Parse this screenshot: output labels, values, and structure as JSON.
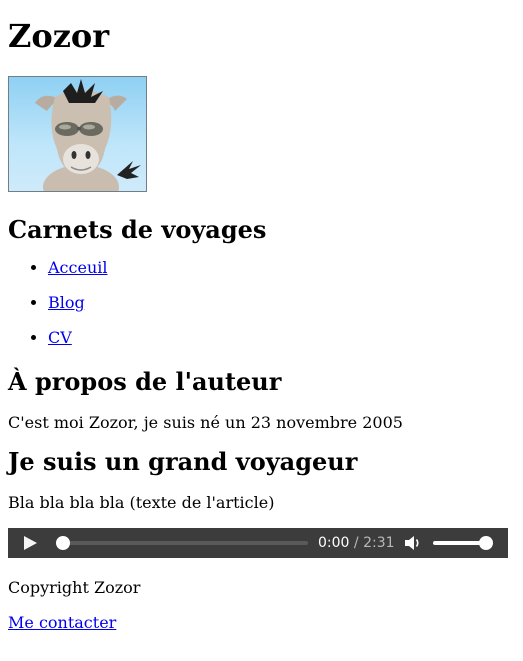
{
  "header": {
    "title": "Zozor",
    "logo_icon": "zozor-donkey-icon"
  },
  "tagline": "Carnets de voyages",
  "nav": {
    "items": [
      {
        "label": "Acceuil"
      },
      {
        "label": "Blog"
      },
      {
        "label": "CV"
      }
    ]
  },
  "about": {
    "heading": "À propos de l'auteur",
    "text": "C'est moi Zozor, je suis né un 23 novembre 2005"
  },
  "article": {
    "heading": "Je suis un grand voyageur",
    "text": "Bla bla bla bla (texte de l'article)"
  },
  "audio_player": {
    "current_time": "0:00",
    "separator": "/",
    "duration": "2:31",
    "progress": 0,
    "volume": 1.0,
    "play_icon": "play-icon",
    "volume_icon": "speaker-icon",
    "colors": {
      "background": "#3c3c3c",
      "controls": "#ffffff"
    }
  },
  "footer": {
    "copyright": "Copyright Zozor",
    "contact_link": "Me contacter"
  }
}
